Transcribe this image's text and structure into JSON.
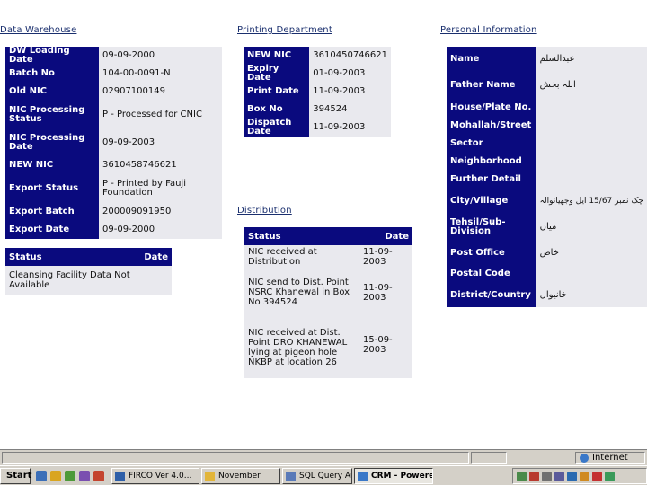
{
  "sections": {
    "data_warehouse": "Data Warehouse",
    "printing_department": "Printing Department",
    "personal_information": "Personal Information",
    "distribution": "Distribution"
  },
  "data_warehouse": [
    {
      "label": "DW Loading Date",
      "value": "09-09-2000"
    },
    {
      "label": "Batch No",
      "value": "104-00-0091-N"
    },
    {
      "label": "Old NIC",
      "value": "02907100149"
    },
    {
      "label": "NIC Processing Status",
      "value": "P - Processed for CNIC"
    },
    {
      "label": "NIC Processing Date",
      "value": "09-09-2003"
    },
    {
      "label": "NEW NIC",
      "value": "3610458746621"
    },
    {
      "label": "Export Status",
      "value": "P - Printed by Fauji Foundation"
    },
    {
      "label": "Export Batch",
      "value": "200009091950"
    },
    {
      "label": "Export Date",
      "value": "09-09-2000"
    }
  ],
  "cleansing_table": {
    "headers": [
      "Status",
      "Date"
    ],
    "message": "Cleansing Facility Data Not Available"
  },
  "printing_department": [
    {
      "label": "NEW NIC",
      "value": "3610450746621"
    },
    {
      "label": "Expiry Date",
      "value": "01-09-2003"
    },
    {
      "label": "Print Date",
      "value": "11-09-2003"
    },
    {
      "label": "Box No",
      "value": "394524"
    },
    {
      "label": "Dispatch Date",
      "value": "11-09-2003"
    }
  ],
  "distribution": {
    "headers": [
      "Status",
      "Date"
    ],
    "rows": [
      {
        "status": "NIC received at Distribution",
        "date": "11-09-2003"
      },
      {
        "status": "NIC send to Dist. Point NSRC Khanewal in Box No 394524",
        "date": "11-09-2003"
      },
      {
        "status": "NIC received at Dist. Point DRO KHANEWAL lying at pigeon hole NKBP at location 26",
        "date": "15-09-2003"
      }
    ]
  },
  "personal_information": [
    {
      "label": "Name",
      "value": "عبدالسلم"
    },
    {
      "label": "Father Name",
      "value": "اللہ بخش"
    },
    {
      "label": "House/Plate No.",
      "value": ""
    },
    {
      "label": "Mohallah/Street",
      "value": ""
    },
    {
      "label": "Sector",
      "value": ""
    },
    {
      "label": "Neighborhood",
      "value": ""
    },
    {
      "label": "Further Detail",
      "value": ""
    },
    {
      "label": "City/Village",
      "value": "چک نمبر 15/67 ایل وجھیانوالہ"
    },
    {
      "label": "Tehsil/Sub-Division",
      "value": "میاں"
    },
    {
      "label": "Post Office",
      "value": "خاص"
    },
    {
      "label": "Postal Code",
      "value": ""
    },
    {
      "label": "District/Country",
      "value": "خانیوال"
    }
  ],
  "statusbar": {
    "zone": "Internet"
  },
  "taskbar": {
    "start": "Start",
    "tasks": [
      {
        "label": "FIRCO Ver 4.0...",
        "active": false
      },
      {
        "label": "November",
        "active": false
      },
      {
        "label": "SQL Query Anal...",
        "active": false
      },
      {
        "label": "CRM - Powere...",
        "active": true
      }
    ]
  },
  "colors": {
    "header_blue": "#0a0a7e",
    "cell_gray": "#e9e9ee",
    "title_blue": "#1a2f6e"
  }
}
